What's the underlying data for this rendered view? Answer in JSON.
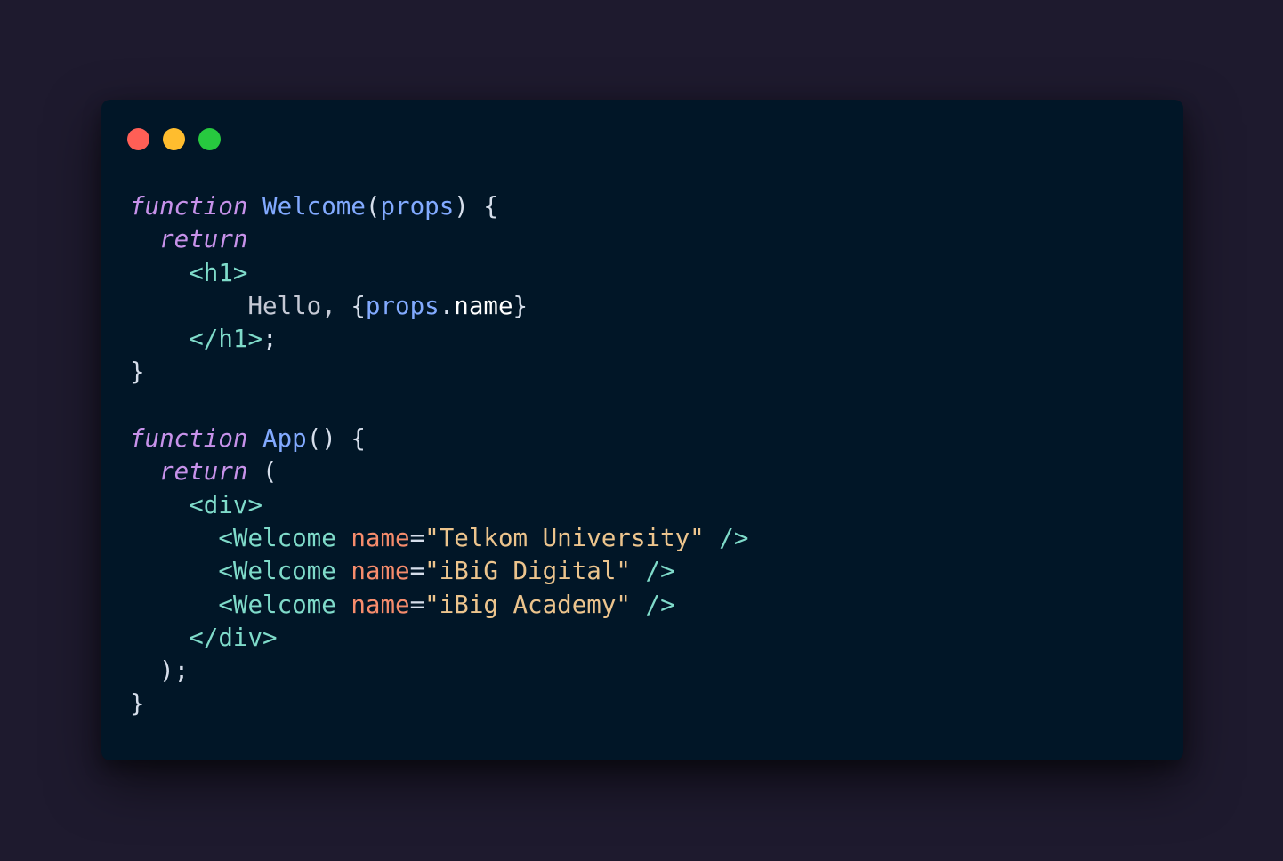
{
  "colors": {
    "page_background": "#1e1a2e",
    "window_background": "#011627",
    "keyword": "#c792ea",
    "function_name": "#82aaff",
    "tag": "#7fdbca",
    "attribute": "#f78c6c",
    "string": "#ecc48d",
    "text": "#c5c9d5",
    "property": "#ffffff",
    "punctuation": "#d6deeb"
  },
  "window_controls": {
    "close_color": "#ff5f56",
    "minimize_color": "#ffbd2e",
    "maximize_color": "#27c93f"
  },
  "code_lines": [
    [
      {
        "t": "function",
        "c": "keyword",
        "i": true
      },
      {
        "t": " "
      },
      {
        "t": "Welcome",
        "c": "function_name"
      },
      {
        "t": "(",
        "c": "punctuation"
      },
      {
        "t": "props",
        "c": "function_name"
      },
      {
        "t": ") {",
        "c": "punctuation"
      }
    ],
    [
      {
        "t": "  "
      },
      {
        "t": "return",
        "c": "keyword",
        "i": true
      }
    ],
    [
      {
        "t": "    "
      },
      {
        "t": "<h1>",
        "c": "tag"
      }
    ],
    [
      {
        "t": "        "
      },
      {
        "t": "Hello, ",
        "c": "text"
      },
      {
        "t": "{",
        "c": "punctuation"
      },
      {
        "t": "props",
        "c": "function_name"
      },
      {
        "t": ".",
        "c": "punctuation"
      },
      {
        "t": "name",
        "c": "property"
      },
      {
        "t": "}",
        "c": "punctuation"
      }
    ],
    [
      {
        "t": "    "
      },
      {
        "t": "</h1>",
        "c": "tag"
      },
      {
        "t": ";",
        "c": "punctuation"
      }
    ],
    [
      {
        "t": "}",
        "c": "punctuation"
      }
    ],
    [
      {
        "t": ""
      }
    ],
    [
      {
        "t": "function",
        "c": "keyword",
        "i": true
      },
      {
        "t": " "
      },
      {
        "t": "App",
        "c": "function_name"
      },
      {
        "t": "() {",
        "c": "punctuation"
      }
    ],
    [
      {
        "t": "  "
      },
      {
        "t": "return",
        "c": "keyword",
        "i": true
      },
      {
        "t": " (",
        "c": "punctuation"
      }
    ],
    [
      {
        "t": "    "
      },
      {
        "t": "<div>",
        "c": "tag"
      }
    ],
    [
      {
        "t": "      "
      },
      {
        "t": "<Welcome",
        "c": "tag"
      },
      {
        "t": " "
      },
      {
        "t": "name",
        "c": "attribute"
      },
      {
        "t": "=",
        "c": "punctuation"
      },
      {
        "t": "\"Telkom University\"",
        "c": "string"
      },
      {
        "t": " "
      },
      {
        "t": "/>",
        "c": "tag"
      }
    ],
    [
      {
        "t": "      "
      },
      {
        "t": "<Welcome",
        "c": "tag"
      },
      {
        "t": " "
      },
      {
        "t": "name",
        "c": "attribute"
      },
      {
        "t": "=",
        "c": "punctuation"
      },
      {
        "t": "\"iBiG Digital\"",
        "c": "string"
      },
      {
        "t": " "
      },
      {
        "t": "/>",
        "c": "tag"
      }
    ],
    [
      {
        "t": "      "
      },
      {
        "t": "<Welcome",
        "c": "tag"
      },
      {
        "t": " "
      },
      {
        "t": "name",
        "c": "attribute"
      },
      {
        "t": "=",
        "c": "punctuation"
      },
      {
        "t": "\"iBig Academy\"",
        "c": "string"
      },
      {
        "t": " "
      },
      {
        "t": "/>",
        "c": "tag"
      }
    ],
    [
      {
        "t": "    "
      },
      {
        "t": "</div>",
        "c": "tag"
      }
    ],
    [
      {
        "t": "  "
      },
      {
        "t": ");",
        "c": "punctuation"
      }
    ],
    [
      {
        "t": "}",
        "c": "punctuation"
      }
    ]
  ]
}
